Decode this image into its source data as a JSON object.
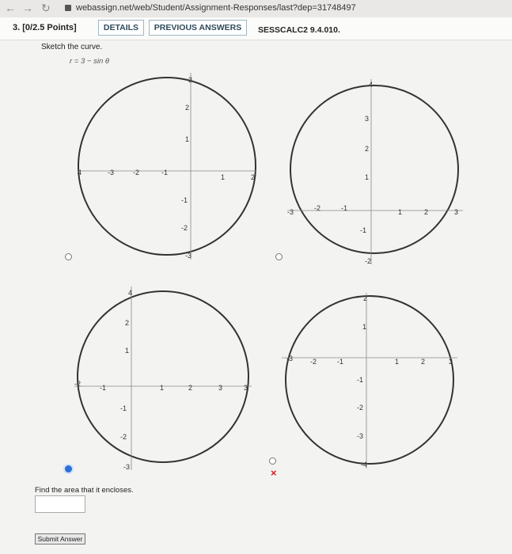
{
  "browser": {
    "url": "webassign.net/web/Student/Assignment-Responses/last?dep=31748497"
  },
  "question": {
    "number_points": "3.  [0/2.5 Points]",
    "details_label": "DETAILS",
    "previous_answers_label": "PREVIOUS ANSWERS",
    "code": "SESSCALC2 9.4.010.",
    "prompt": "Sketch the curve.",
    "equation": "r = 3 − sin θ",
    "find_prompt": "Find the area that it encloses.",
    "answer_value": "",
    "submit_label": "Submit Answer"
  },
  "options": [
    {
      "selected": false,
      "xticks": [
        "-3",
        "-2",
        "-1",
        "1"
      ],
      "yticks": [
        "2",
        "1",
        "-1",
        "-2"
      ],
      "edge_labels": [
        "4",
        "3",
        "-3",
        "2"
      ]
    },
    {
      "selected": false,
      "xticks": [
        "-2",
        "-1",
        "1",
        "2"
      ],
      "yticks": [
        "3",
        "2",
        "1",
        "-1"
      ],
      "edge_labels": [
        "-3",
        "3",
        "4",
        "-2"
      ]
    },
    {
      "selected": true,
      "xticks": [
        "-1",
        "1",
        "2",
        "3"
      ],
      "yticks": [
        "2",
        "1",
        "-1",
        "-2"
      ],
      "edge_labels": [
        "-2",
        "4",
        "3",
        "-3"
      ]
    },
    {
      "selected": false,
      "xticks": [
        "-2",
        "-1",
        "1",
        "2"
      ],
      "yticks": [
        "1",
        "-1",
        "-2",
        "-3"
      ],
      "edge_labels": [
        "-3",
        "3",
        "2",
        "-4"
      ]
    }
  ],
  "marks": {
    "wrong": "×"
  }
}
